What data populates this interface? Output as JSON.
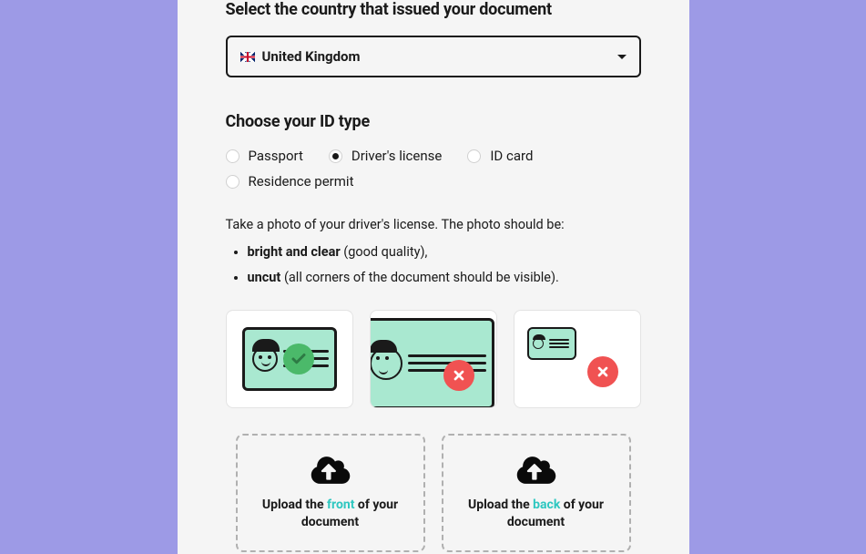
{
  "heading_country": "Select the country that issued your document",
  "country": {
    "selected": "United Kingdom"
  },
  "heading_idtype": "Choose your ID type",
  "id_options": {
    "passport": "Passport",
    "drivers": "Driver's license",
    "idcard": "ID card",
    "residence": "Residence permit",
    "selected": "drivers"
  },
  "instruction": "Take a photo of your driver's license. The photo should be:",
  "bullets": {
    "b1_strong": "bright and clear",
    "b1_rest": " (good quality),",
    "b2_strong": "uncut",
    "b2_rest": " (all corners of the document should be visible)."
  },
  "upload": {
    "front": {
      "pre": "Upload the ",
      "hl": "front",
      "post": " of your document"
    },
    "back": {
      "pre": "Upload the ",
      "hl": "back",
      "post": " of your document"
    }
  }
}
